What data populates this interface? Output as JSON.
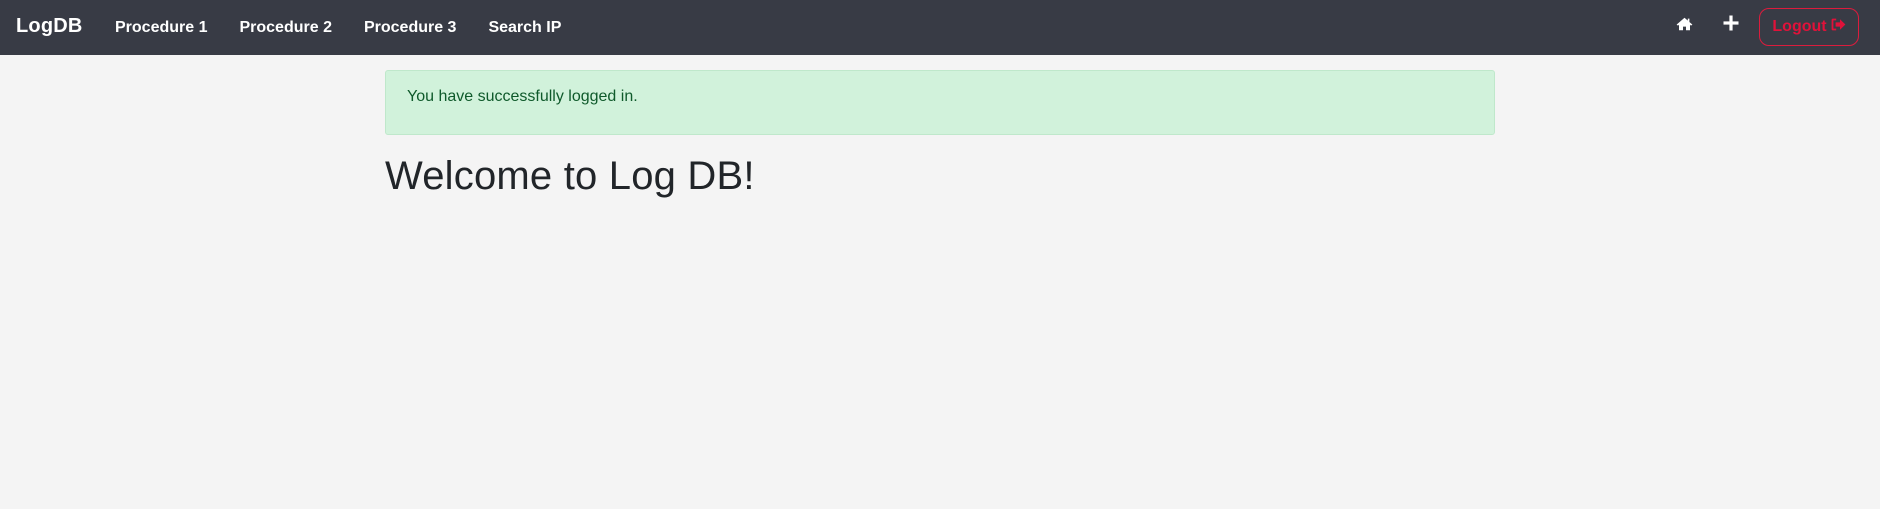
{
  "navbar": {
    "brand": "LogDB",
    "links": [
      {
        "label": "Procedure 1"
      },
      {
        "label": "Procedure 2"
      },
      {
        "label": "Procedure 3"
      },
      {
        "label": "Search IP"
      }
    ],
    "home_icon": "home-icon",
    "add_icon": "plus-icon",
    "logout_label": "Logout",
    "logout_icon": "sign-out-icon"
  },
  "alert": {
    "message": "You have successfully logged in."
  },
  "main": {
    "heading": "Welcome to Log DB!"
  },
  "colors": {
    "navbar_bg": "#383b45",
    "logout_accent": "#e0123a",
    "alert_bg": "#d1f2db",
    "alert_text": "#0f5a2b"
  }
}
